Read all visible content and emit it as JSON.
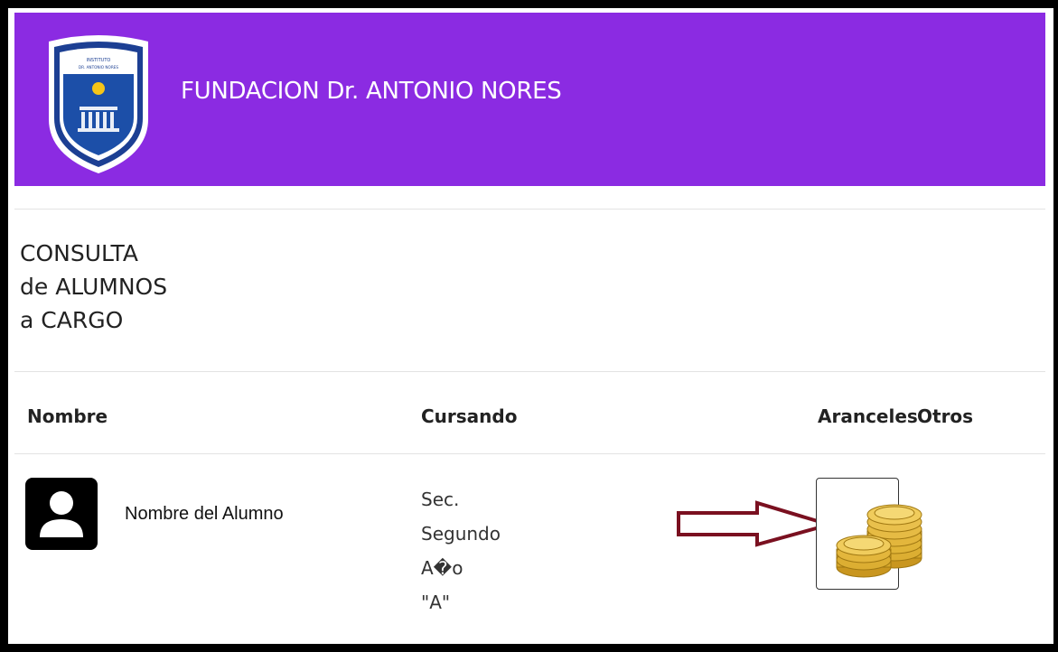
{
  "header": {
    "brand_title": "FUNDACION Dr. ANTONIO NORES",
    "logo_text_line1": "INSTITUTO",
    "logo_text_line2": "DR. ANTONIO NORES"
  },
  "page": {
    "title_lines": [
      "CONSULTA",
      "de ALUMNOS",
      "a CARGO"
    ]
  },
  "table": {
    "columns": [
      "Nombre",
      "Cursando",
      "Aranceles",
      "Otros"
    ],
    "rows": [
      {
        "nombre": "Nombre del Alumno",
        "cursando": [
          "Sec.",
          "Segundo",
          "A�o",
          "\"A\""
        ]
      }
    ]
  },
  "colors": {
    "header_bg": "#8b2be2",
    "arrow": "#7a1020",
    "coin": "#e3b63c"
  },
  "icons": {
    "avatar": "person-icon",
    "aranceles": "coins-icon",
    "pointer": "arrow-right-icon"
  }
}
